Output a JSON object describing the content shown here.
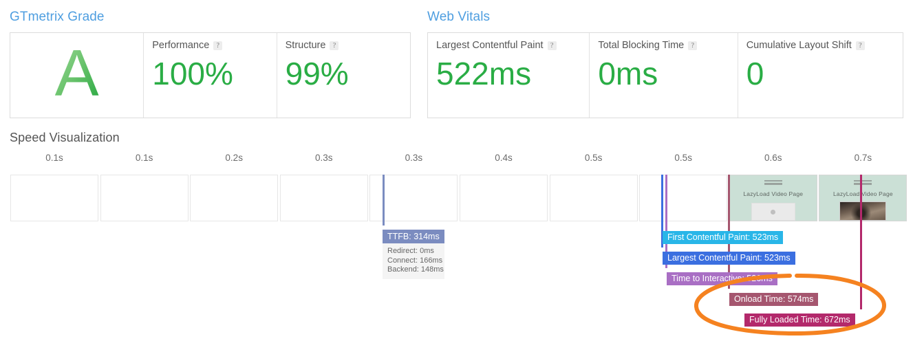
{
  "grade": {
    "heading": "GTmetrix Grade",
    "letter": "A",
    "metrics": [
      {
        "label": "Performance",
        "value": "100%",
        "help": "?"
      },
      {
        "label": "Structure",
        "value": "99%",
        "help": "?"
      }
    ]
  },
  "web_vitals": {
    "heading": "Web Vitals",
    "metrics": [
      {
        "label": "Largest Contentful Paint",
        "value": "522ms",
        "help": "?"
      },
      {
        "label": "Total Blocking Time",
        "value": "0ms",
        "help": "?"
      },
      {
        "label": "Cumulative Layout Shift",
        "value": "0",
        "help": "?"
      }
    ]
  },
  "speed_visualization": {
    "heading": "Speed Visualization",
    "tick_labels": [
      "0.1s",
      "0.1s",
      "0.2s",
      "0.3s",
      "0.3s",
      "0.4s",
      "0.5s",
      "0.5s",
      "0.6s",
      "0.7s"
    ],
    "frames": [
      {
        "state": "blank",
        "title": ""
      },
      {
        "state": "blank",
        "title": ""
      },
      {
        "state": "blank",
        "title": ""
      },
      {
        "state": "blank",
        "title": ""
      },
      {
        "state": "blank",
        "title": ""
      },
      {
        "state": "blank",
        "title": ""
      },
      {
        "state": "blank",
        "title": ""
      },
      {
        "state": "blank",
        "title": ""
      },
      {
        "state": "rendered-placeholder",
        "title": "LazyLoad Video Page"
      },
      {
        "state": "rendered-video",
        "title": "LazyLoad Video Page"
      }
    ],
    "ttfb": {
      "title": "TTFB: 314ms",
      "redirect": "Redirect: 0ms",
      "connect": "Connect: 166ms",
      "backend": "Backend: 148ms",
      "color": "#7b8cc0"
    },
    "events": [
      {
        "name": "first-contentful-paint",
        "label": "First Contentful Paint: 523ms",
        "color": "#29b6e8"
      },
      {
        "name": "largest-contentful-paint",
        "label": "Largest Contentful Paint: 523ms",
        "color": "#3b6fe0"
      },
      {
        "name": "time-to-interactive",
        "label": "Time to Interactive: 526ms",
        "color": "#a96fc4"
      },
      {
        "name": "onload-time",
        "label": "Onload Time: 574ms",
        "color": "#a5566f"
      },
      {
        "name": "fully-loaded-time",
        "label": "Fully Loaded Time: 672ms",
        "color": "#b3296b"
      }
    ],
    "annotation": {
      "name": "highlight-ellipse",
      "color": "#f58220"
    }
  },
  "colors": {
    "heading_blue": "#4e9ee0",
    "score_green": "#2aad45",
    "panel_border": "#dcdcdc"
  }
}
